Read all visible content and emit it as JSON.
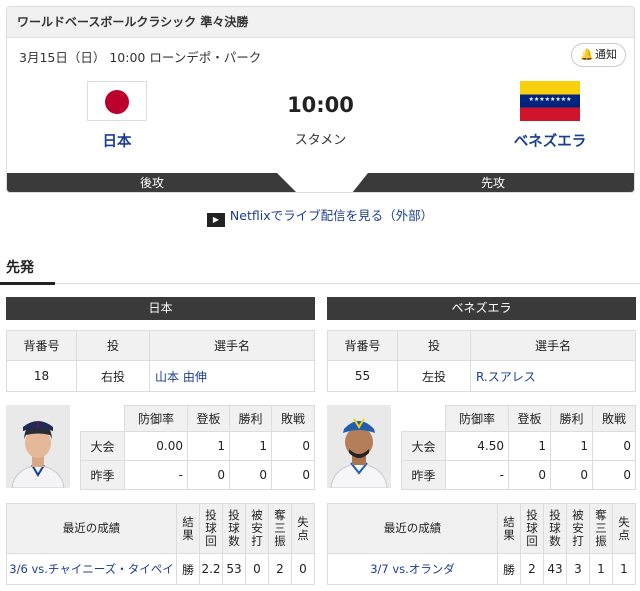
{
  "header": {
    "title": "ワールドベースボールクラシック 準々決勝",
    "date_venue": "3月15日（日） 10:00 ローンデポ・パーク",
    "notify_label": "通知",
    "time": "10:00",
    "status": "スタメン",
    "home": {
      "name": "日本",
      "order": "後攻"
    },
    "away": {
      "name": "ベネズエラ",
      "order": "先攻"
    }
  },
  "netflix": {
    "label": "Netflixでライブ配信を見る（外部）"
  },
  "section": {
    "title": "先発"
  },
  "columns": {
    "number": "背番号",
    "throw": "投",
    "player": "選手名",
    "era": "防御率",
    "games": "登板",
    "wins": "勝利",
    "losses": "敗戦",
    "recent": "最近の成績",
    "result": "結果",
    "innings": "投球回",
    "pitches": "投球数",
    "hits": "被安打",
    "strikeouts": "奪三振",
    "runs": "失点"
  },
  "japan": {
    "header": "日本",
    "number": "18",
    "throw": "右投",
    "player": "山本 由伸",
    "stats": [
      {
        "label": "大会",
        "era": "0.00",
        "games": "1",
        "wins": "1",
        "losses": "0"
      },
      {
        "label": "昨季",
        "era": "-",
        "games": "0",
        "wins": "0",
        "losses": "0"
      }
    ],
    "recent": {
      "game": "3/6 vs.チャイニーズ・タイペイ",
      "result": "勝",
      "innings": "2.2",
      "pitches": "53",
      "hits": "0",
      "strikeouts": "2",
      "runs": "0"
    }
  },
  "venezuela": {
    "header": "ベネズエラ",
    "number": "55",
    "throw": "左投",
    "player": "R.スアレス",
    "stats": [
      {
        "label": "大会",
        "era": "4.50",
        "games": "1",
        "wins": "1",
        "losses": "0"
      },
      {
        "label": "昨季",
        "era": "-",
        "games": "0",
        "wins": "0",
        "losses": "0"
      }
    ],
    "recent": {
      "game": "3/7 vs.オランダ",
      "result": "勝",
      "innings": "2",
      "pitches": "43",
      "hits": "3",
      "strikeouts": "1",
      "runs": "1"
    }
  }
}
